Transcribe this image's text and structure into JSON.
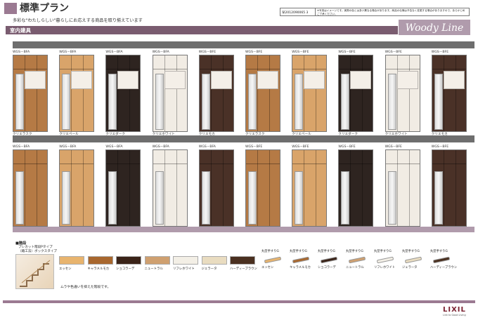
{
  "header": {
    "title": "標準プラン",
    "subtitle": "多彩な\"わたしらしい\"暮らしにお応えする商品を取り揃えています",
    "doc_number": "早2012090065 3",
    "doc_note": "※写真はイメージです。実際の色とは多少異なる場合があります。商品の仕様は予告なく変更する場合がありますので、あらかじめご了承ください。"
  },
  "section": {
    "label": "室内建具",
    "logo": "Woody Line"
  },
  "row1": {
    "title": "玄関収納　W1185コの字1型ミラー付",
    "items": [
      {
        "model": "WGS－BFA",
        "name": "クリエラスク",
        "color": "#b57a45"
      },
      {
        "model": "WGS－BFA",
        "name": "クリエベール",
        "color": "#d9a46a"
      },
      {
        "model": "WGS－BFA",
        "name": "クリエダーク",
        "color": "#2e2420"
      },
      {
        "model": "WGS－BFA",
        "name": "クリエホワイト",
        "color": "#f1ece4"
      },
      {
        "model": "WGS－BFE",
        "name": "クリエモカ",
        "color": "#4a3127"
      },
      {
        "model": "WGS－BFE",
        "name": "クリエラスク",
        "color": "#b57a45"
      },
      {
        "model": "WGS－BFE",
        "name": "クリエベール",
        "color": "#d9a46a"
      },
      {
        "model": "WGS－BFE",
        "name": "クリエダーク",
        "color": "#2e2420"
      },
      {
        "model": "WGS－BFE",
        "name": "クリエホワイト",
        "color": "#f1ece4"
      },
      {
        "model": "WGS－BFE",
        "name": "クリエモカ",
        "color": "#4a3127"
      }
    ]
  },
  "row2": {
    "title": "玄関収納　W1185ロッカー型ミラー付",
    "items": [
      {
        "model": "WGS－BFA",
        "name": "クリエラスク",
        "color": "#b57a45"
      },
      {
        "model": "WGS－BFA",
        "name": "クリエベール",
        "color": "#d9a46a"
      },
      {
        "model": "WGS－BFA",
        "name": "クリエダーク",
        "color": "#2e2420"
      },
      {
        "model": "WGS－BFA",
        "name": "クリエホワイト",
        "color": "#f1ece4"
      },
      {
        "model": "WGS－BFA",
        "name": "クリエモカ",
        "color": "#4a3127"
      },
      {
        "model": "WGS－BFE",
        "name": "クリエラスク",
        "color": "#b57a45"
      },
      {
        "model": "WGS－BFE",
        "name": "クリエベール",
        "color": "#d9a46a"
      },
      {
        "model": "WGS－BFE",
        "name": "クリエダーク",
        "color": "#2e2420"
      },
      {
        "model": "WGS－BFE",
        "name": "クリエホワイト",
        "color": "#f1ece4"
      },
      {
        "model": "WGS－BFE",
        "name": "クリエモカ",
        "color": "#4a3127"
      }
    ]
  },
  "stairs": {
    "band_label": "階段",
    "label": "■階段",
    "desc_line1": "プレカット階段Pタイプ",
    "desc_line2": "（箱工法）ボックスタイプ",
    "swatches": [
      {
        "name": "エッセン",
        "color": "#e8b46e"
      },
      {
        "name": "キャラメルモカ",
        "color": "#a8672e"
      },
      {
        "name": "ショコラーデ",
        "color": "#3a2318"
      },
      {
        "name": "ニュートラル",
        "color": "#cfa070"
      },
      {
        "name": "リフレホワイト",
        "color": "#f3efe6"
      },
      {
        "name": "ジェラータ",
        "color": "#e9dcc0"
      },
      {
        "name": "ハーディーブラウン",
        "color": "#4a3020"
      }
    ],
    "handrail_label": "丸型手すりG",
    "handrails": [
      {
        "name": "エッセン",
        "color": "#e8b46e"
      },
      {
        "name": "キャラメルモカ",
        "color": "#a8672e"
      },
      {
        "name": "ショコラーデ",
        "color": "#3a2318"
      },
      {
        "name": "ニュートラル",
        "color": "#cfa070"
      },
      {
        "name": "リフレホワイト",
        "color": "#f3efe6"
      },
      {
        "name": "ジェラータ",
        "color": "#e9dcc0"
      },
      {
        "name": "ハーディーブラウン",
        "color": "#4a3020"
      }
    ],
    "note": "ムラや色違いを抑えた階段です。"
  },
  "footer": {
    "brand": "LIXIL",
    "tagline": "Link to Good Living"
  }
}
